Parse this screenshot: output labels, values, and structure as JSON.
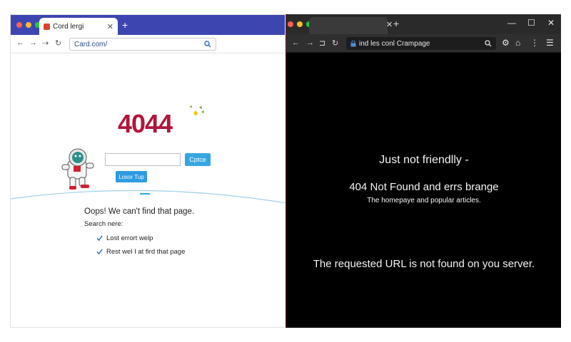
{
  "left": {
    "tab_title": "Cord lergi",
    "url": "Card.com/",
    "error_code": "4044",
    "search_button": "Cptce",
    "home_button": "Losor Tup",
    "oops": "Oops!  We can't find that page.",
    "search_here": "Search nere:",
    "list": [
      "Lost errort welp",
      "Rest wel I at fird that page"
    ],
    "colors": {
      "tabbar": "#3d46b0",
      "error": "#b0163a",
      "button": "#36a6e0"
    }
  },
  "right": {
    "url": "ind les conl Crampage",
    "heading": "Just not friendlly -",
    "subheading": "404 Not Found and errs brange",
    "description": "The homepaye and popular articles.",
    "message": "The requested URL is no͏t found on you server.",
    "colors": {
      "background": "#000000",
      "tabbar": "#2a2a2a"
    }
  }
}
